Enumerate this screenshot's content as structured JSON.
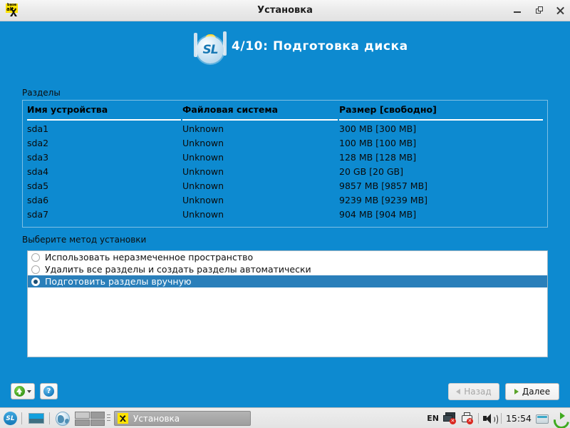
{
  "window": {
    "title": "Установка",
    "icon": "basealt-logo-icon",
    "controls": {
      "minimize": "minimize-icon",
      "restore": "restore-icon",
      "close": "close-icon"
    }
  },
  "header": {
    "logo": "simply-linux-sl-logo-icon",
    "step_title": "4/10: Подготовка диска"
  },
  "partitions": {
    "section_label": "Разделы",
    "columns": [
      "Имя устройства",
      "Файловая система",
      "Размер [свободно]"
    ],
    "rows": [
      {
        "device": "sda1",
        "fs": "Unknown",
        "size": "300 MB [300 MB]"
      },
      {
        "device": "sda2",
        "fs": "Unknown",
        "size": "100 MB [100 MB]"
      },
      {
        "device": "sda3",
        "fs": "Unknown",
        "size": "128 MB [128 MB]"
      },
      {
        "device": "sda4",
        "fs": "Unknown",
        "size": "20 GB [20 GB]"
      },
      {
        "device": "sda5",
        "fs": "Unknown",
        "size": "9857 MB [9857 MB]"
      },
      {
        "device": "sda6",
        "fs": "Unknown",
        "size": "9239 MB [9239 MB]"
      },
      {
        "device": "sda7",
        "fs": "Unknown",
        "size": "904 MB [904 MB]"
      }
    ]
  },
  "method": {
    "section_label": "Выберите метод установки",
    "options": [
      {
        "label": "Использовать неразмеченное пространство",
        "selected": false
      },
      {
        "label": "Удалить все разделы и создать разделы автоматически",
        "selected": false
      },
      {
        "label": "Подготовить разделы вручную",
        "selected": true
      }
    ]
  },
  "footer": {
    "upload_button": "green-up-arrow-icon",
    "help_button": "question-mark-icon",
    "back_label": "Назад",
    "next_label": "Далее"
  },
  "taskbar": {
    "launcher": "SL",
    "pager_icon": "workspace-pager-icon",
    "task_label": "Установка",
    "tray": {
      "keyboard_layout": "EN",
      "network_icon": "network-disconnected-icon",
      "printer_icon": "printer-error-icon",
      "volume_icon": "volume-speaker-icon",
      "clock": "15:54",
      "drive_icon": "removable-drive-icon",
      "logout_icon": "logout-power-icon"
    }
  },
  "colors": {
    "background_blue": "#0d8ad0",
    "selection_blue": "#2a7fba",
    "accent_green": "#3faa1f",
    "titlebar_gray": "#eaeaea"
  }
}
